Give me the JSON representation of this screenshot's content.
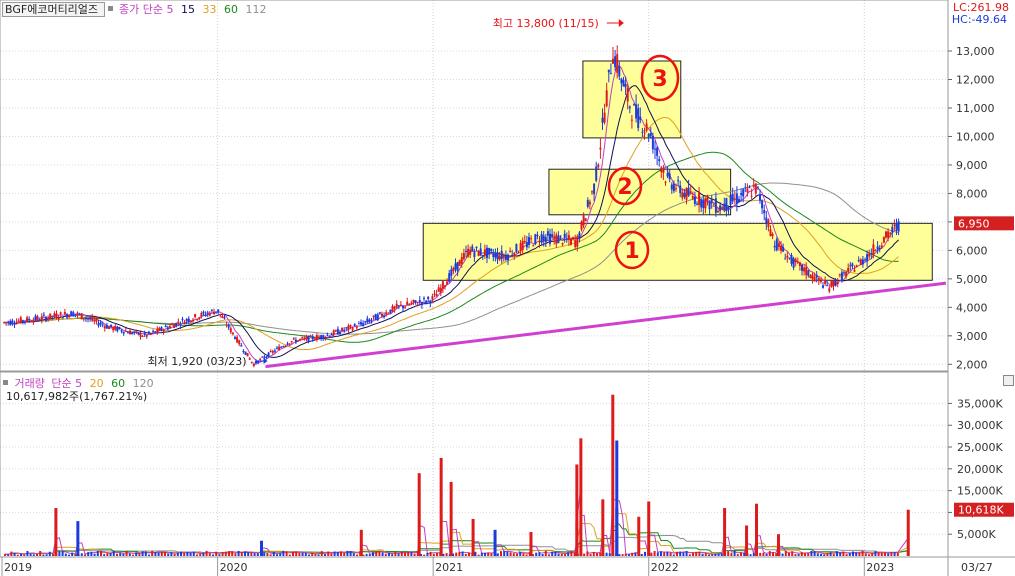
{
  "colors": {
    "up": "#dd1b1b",
    "down": "#1b3cdd",
    "ma5": "#c040c0",
    "ma15": "#101050",
    "ma33": "#e0a020",
    "ma60": "#1a8a1a",
    "ma112": "#909090",
    "trendline": "#d040d0",
    "highlight_fill": "#ffff99",
    "annotation": "#ee1111"
  },
  "price_header": {
    "ticker": "BGF에코머티리얼즈",
    "label_close": "종가",
    "label_simple": "단순",
    "ma_periods": [
      "5",
      "15",
      "33",
      "60",
      "112"
    ],
    "lc": "LC:261.98",
    "hc": "HC:-49.64"
  },
  "volume_header": {
    "label_volume": "거래량",
    "label_simple": "단순",
    "ma_periods": [
      "5",
      "20",
      "60",
      "120"
    ],
    "last_volume": "10,617,982주(1,767.21%)"
  },
  "annotations": {
    "high": "최고 13,800 (11/15)",
    "low": "최저 1,920 (03/23)",
    "box_numbers": [
      "1",
      "2",
      "3"
    ]
  },
  "current_price_tag": "6,950",
  "current_volume_tag": "10,618K",
  "x_axis": {
    "years": [
      "2019",
      "2020",
      "2021",
      "2022",
      "2023"
    ],
    "corner_date": "03/27"
  },
  "chart_data": [
    {
      "type": "line",
      "title": "BGF에코머티리얼즈 종가 단순 5 15 33 60 112",
      "yticks": [
        "2,000",
        "3,000",
        "4,000",
        "5,000",
        "6,000",
        "7,000",
        "8,000",
        "9,000",
        "10,000",
        "11,000",
        "12,000",
        "13,000"
      ],
      "ylim": [
        1800,
        14300
      ],
      "x": [
        "2019-01",
        "2019-03",
        "2019-05",
        "2019-07",
        "2019-09",
        "2019-11",
        "2020-01",
        "2020-03",
        "2020-05",
        "2020-07",
        "2020-09",
        "2020-11",
        "2021-01",
        "2021-03",
        "2021-05",
        "2021-07",
        "2021-09",
        "2021-10",
        "2021-11",
        "2021-12",
        "2022-01",
        "2022-02",
        "2022-03",
        "2022-05",
        "2022-07",
        "2022-08",
        "2022-09",
        "2022-11",
        "2023-01",
        "2023-03"
      ],
      "series": [
        {
          "name": "종가",
          "values": [
            3450,
            3600,
            3800,
            3300,
            3000,
            3500,
            3900,
            2000,
            2800,
            3000,
            3400,
            4000,
            4300,
            6000,
            5800,
            6500,
            6300,
            8300,
            13000,
            11000,
            10200,
            8500,
            8000,
            7500,
            8200,
            6300,
            5600,
            4700,
            5700,
            6950
          ]
        }
      ],
      "highlight_boxes": [
        {
          "label": "1",
          "price_range": [
            4950,
            6950
          ]
        },
        {
          "label": "2",
          "price_range": [
            7250,
            8850
          ]
        },
        {
          "label": "3",
          "price_range": [
            9950,
            12650
          ]
        }
      ],
      "trendline": {
        "from": [
          "2020-03",
          1920
        ],
        "to": [
          "2023-03",
          4850
        ]
      },
      "grid": true
    },
    {
      "type": "bar",
      "title": "거래량 단순 5 20 60 120",
      "yticks": [
        "5,000K",
        "10,000K",
        "15,000K",
        "20,000K",
        "25,000K",
        "30,000K",
        "35,000K"
      ],
      "ylim": [
        0,
        39000
      ],
      "bars": [
        {
          "x": "2019-04",
          "value": 11000,
          "dir": "up"
        },
        {
          "x": "2019-05",
          "value": 8000,
          "dir": "down"
        },
        {
          "x": "2020-03",
          "value": 3500,
          "dir": "down"
        },
        {
          "x": "2020-09",
          "value": 6000,
          "dir": "up"
        },
        {
          "x": "2020-12",
          "value": 19000,
          "dir": "up"
        },
        {
          "x": "2021-06",
          "value": 5500,
          "dir": "up"
        },
        {
          "x": "2021-09",
          "value": 8000,
          "dir": "up"
        },
        {
          "x": "2021-11",
          "value": 11000,
          "dir": "down"
        },
        {
          "x": "2021-01",
          "value": 22500,
          "dir": "up"
        },
        {
          "x": "2021-02",
          "value": 17000,
          "dir": "up"
        },
        {
          "x": "2021-03",
          "value": 8500,
          "dir": "up"
        },
        {
          "x": "2021-04",
          "value": 6000,
          "dir": "down"
        },
        {
          "x": "2021-09",
          "value": 21000,
          "dir": "up"
        },
        {
          "x": "2021-09",
          "value": 27000,
          "dir": "up"
        },
        {
          "x": "2021-10",
          "value": 13000,
          "dir": "up"
        },
        {
          "x": "2021-11",
          "value": 37000,
          "dir": "up"
        },
        {
          "x": "2021-11",
          "value": 26500,
          "dir": "down"
        },
        {
          "x": "2021-12",
          "value": 9000,
          "dir": "up"
        },
        {
          "x": "2022-01",
          "value": 12500,
          "dir": "up"
        },
        {
          "x": "2022-05",
          "value": 11000,
          "dir": "up"
        },
        {
          "x": "2022-06",
          "value": 7000,
          "dir": "up"
        },
        {
          "x": "2022-07",
          "value": 12000,
          "dir": "up"
        },
        {
          "x": "2022-08",
          "value": 5000,
          "dir": "up"
        },
        {
          "x": "2023-03",
          "value": 10618,
          "dir": "up"
        }
      ],
      "grid": true
    }
  ]
}
